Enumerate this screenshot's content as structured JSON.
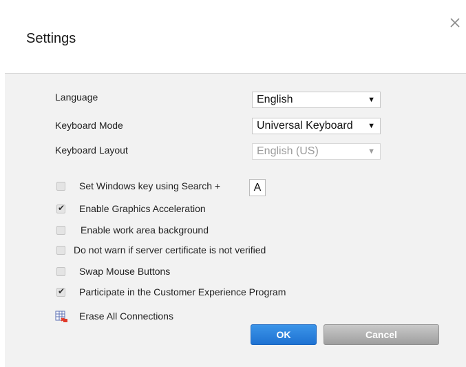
{
  "dialog": {
    "title": "Settings",
    "close_icon": "close-icon"
  },
  "fields": {
    "language": {
      "label": "Language",
      "value": "English"
    },
    "keyboard_mode": {
      "label": "Keyboard Mode",
      "value": "Universal Keyboard"
    },
    "keyboard_layout": {
      "label": "Keyboard Layout",
      "value": "English (US)",
      "disabled": true
    }
  },
  "options": [
    {
      "label": "Set Windows key using Search +",
      "checked": false
    },
    {
      "label": "Enable Graphics Acceleration",
      "checked": true
    },
    {
      "label": "Enable work area background",
      "checked": false
    },
    {
      "label": "Do not warn if server certificate is not verified",
      "checked": false
    },
    {
      "label": "Swap Mouse Buttons",
      "checked": false
    },
    {
      "label": "Participate in the Customer Experience Program",
      "checked": true
    }
  ],
  "search_key": "A",
  "erase": {
    "label": "Erase All Connections",
    "icon": "erase-table-icon"
  },
  "buttons": {
    "ok": "OK",
    "cancel": "Cancel"
  },
  "colors": {
    "ok_blue": "#2a82e0",
    "cancel_gray": "#b0b0b0",
    "panel_bg": "#f2f2f2"
  }
}
